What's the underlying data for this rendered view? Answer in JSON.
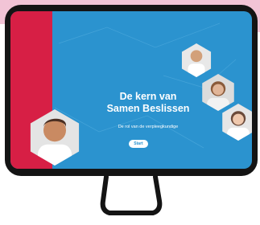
{
  "app": {
    "title_line1": "De kern van",
    "title_line2": "Samen Beslissen",
    "subtitle": "De rol van de verpleegkundige",
    "start_button": "Start"
  },
  "colors": {
    "background_pink": "#f2c4d6",
    "frame": "#141414",
    "screen_blue": "#2b93cf",
    "accent_red": "#d71f45",
    "text_white": "#ffffff"
  },
  "avatars": [
    {
      "icon": "person-avatar-icon"
    },
    {
      "icon": "person-avatar-icon"
    },
    {
      "icon": "person-avatar-icon"
    },
    {
      "icon": "person-avatar-icon"
    }
  ]
}
